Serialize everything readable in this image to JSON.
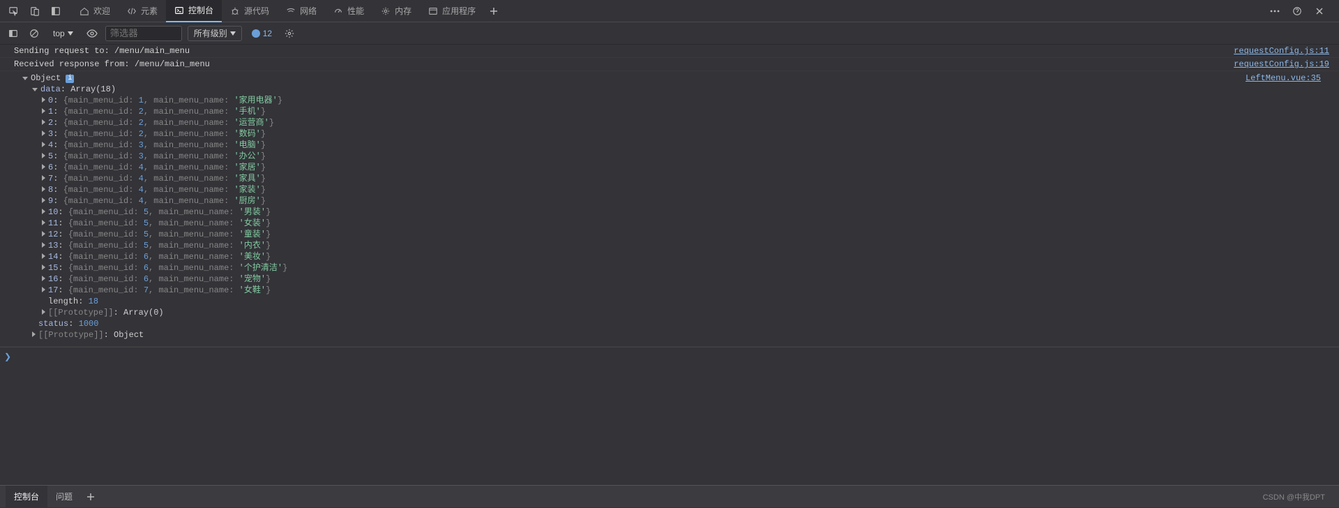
{
  "topTabs": {
    "welcome": "欢迎",
    "elements": "元素",
    "console": "控制台",
    "sources": "源代码",
    "network": "网络",
    "performance": "性能",
    "memory": "内存",
    "application": "应用程序"
  },
  "filterBar": {
    "topContext": "top",
    "filterPlaceholder": "筛选器",
    "levelDropdown": "所有级别",
    "messageCount": "12"
  },
  "logs": [
    {
      "msg": "Sending request to: /menu/main_menu",
      "src": "requestConfig.js:11"
    },
    {
      "msg": "Received response from: /menu/main_menu",
      "src": "requestConfig.js:19"
    }
  ],
  "objectDump": {
    "header": "Object",
    "srcRef": "LeftMenu.vue:35",
    "dataLabel": "data",
    "dataVal": "Array(18)",
    "items": [
      {
        "idx": "0",
        "id": "1",
        "name": "家用电器"
      },
      {
        "idx": "1",
        "id": "2",
        "name": "手机"
      },
      {
        "idx": "2",
        "id": "2",
        "name": "运营商"
      },
      {
        "idx": "3",
        "id": "2",
        "name": "数码"
      },
      {
        "idx": "4",
        "id": "3",
        "name": "电脑"
      },
      {
        "idx": "5",
        "id": "3",
        "name": "办公"
      },
      {
        "idx": "6",
        "id": "4",
        "name": "家居"
      },
      {
        "idx": "7",
        "id": "4",
        "name": "家具"
      },
      {
        "idx": "8",
        "id": "4",
        "name": "家装"
      },
      {
        "idx": "9",
        "id": "4",
        "name": "厨房"
      },
      {
        "idx": "10",
        "id": "5",
        "name": "男装"
      },
      {
        "idx": "11",
        "id": "5",
        "name": "女装"
      },
      {
        "idx": "12",
        "id": "5",
        "name": "童装"
      },
      {
        "idx": "13",
        "id": "5",
        "name": "内衣"
      },
      {
        "idx": "14",
        "id": "6",
        "name": "美妆"
      },
      {
        "idx": "15",
        "id": "6",
        "name": "个护清洁"
      },
      {
        "idx": "16",
        "id": "6",
        "name": "宠物"
      },
      {
        "idx": "17",
        "id": "7",
        "name": "女鞋"
      }
    ],
    "lengthLabel": "length",
    "lengthVal": "18",
    "proto1": "[[Prototype]]",
    "proto1Val": "Array(0)",
    "statusLabel": "status",
    "statusVal": "1000",
    "proto2": "[[Prototype]]",
    "proto2Val": "Object"
  },
  "bottomTabs": {
    "console": "控制台",
    "issues": "问题"
  },
  "watermark": "CSDN @中我DPT"
}
